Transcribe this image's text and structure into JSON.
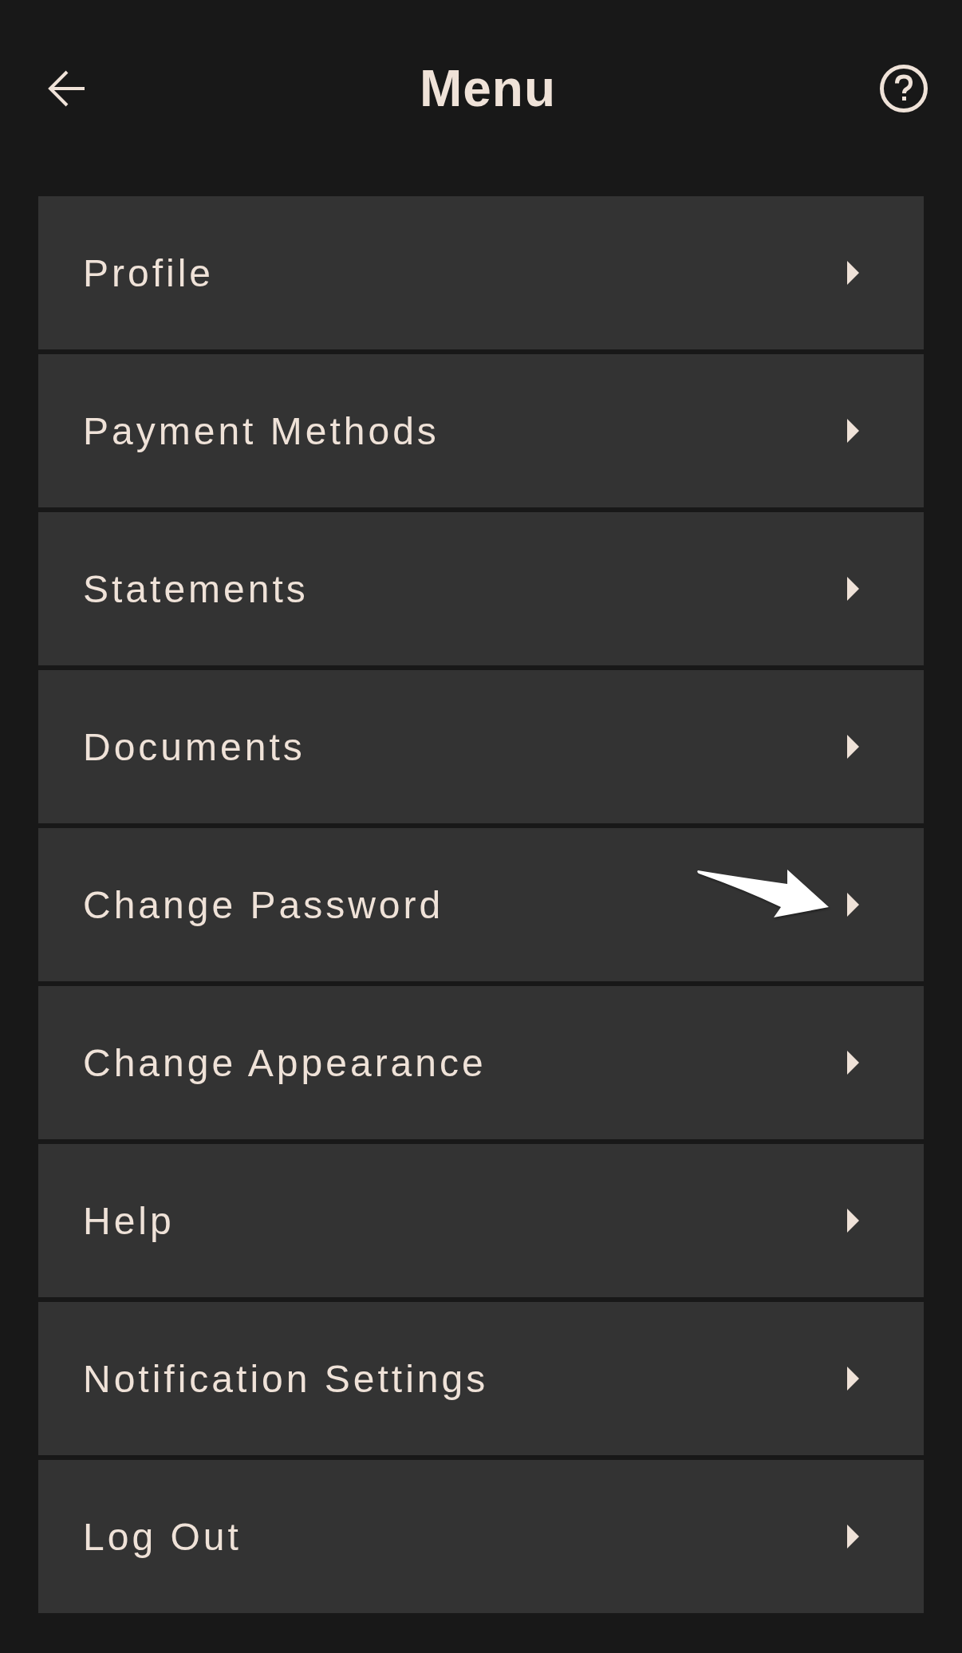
{
  "header": {
    "title": "Menu"
  },
  "menu_items": [
    {
      "label": "Profile",
      "arrow_annotation": false
    },
    {
      "label": "Payment Methods",
      "arrow_annotation": false
    },
    {
      "label": "Statements",
      "arrow_annotation": false
    },
    {
      "label": "Documents",
      "arrow_annotation": false
    },
    {
      "label": "Change Password",
      "arrow_annotation": true
    },
    {
      "label": "Change Appearance",
      "arrow_annotation": false
    },
    {
      "label": "Help",
      "arrow_annotation": false
    },
    {
      "label": "Notification Settings",
      "arrow_annotation": false
    },
    {
      "label": "Log Out",
      "arrow_annotation": false
    }
  ]
}
